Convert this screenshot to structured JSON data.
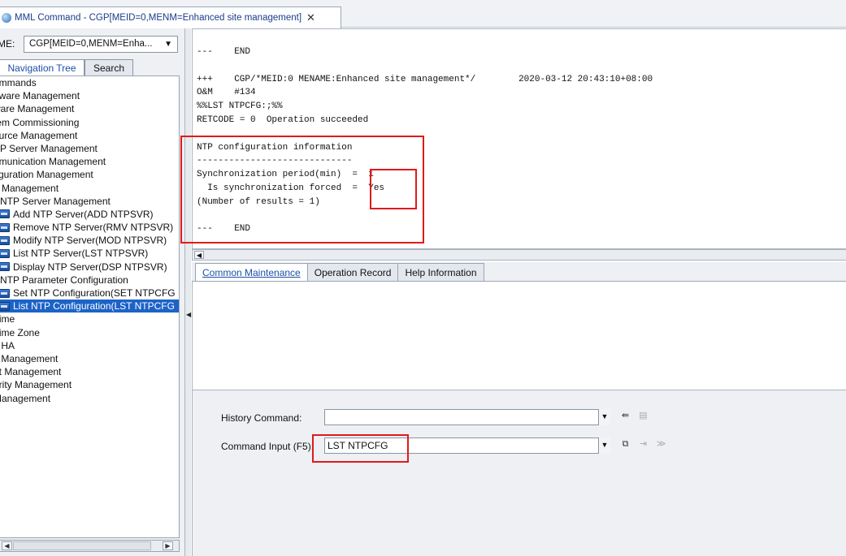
{
  "document_tab": {
    "title": "MML Command - CGP[MEID=0,MENM=Enhanced site management]",
    "close_glyph": "✕",
    "icon": "globe-icon"
  },
  "left_panel": {
    "ne_label": "ME:",
    "ne_value": "CGP[MEID=0,MENM=Enha...",
    "tabs": [
      "Navigation Tree",
      "Search"
    ],
    "tree": [
      {
        "label": "ommands",
        "level": 1
      },
      {
        "label": "dware Management",
        "level": 1
      },
      {
        "label": "ware Management",
        "level": 1
      },
      {
        "label": "tem Commissioning",
        "level": 1
      },
      {
        "label": "ource Management",
        "level": 1
      },
      {
        "label": "AP Server Management",
        "level": 1
      },
      {
        "label": "nmunication Management",
        "level": 1
      },
      {
        "label": "figuration Management",
        "level": 1
      },
      {
        "label": "e Management",
        "level": 1
      },
      {
        "label": "NTP Server Management",
        "level": 2
      },
      {
        "label": "Add NTP Server(ADD NTPSVR)",
        "level": 3
      },
      {
        "label": "Remove NTP Server(RMV NTPSVR)",
        "level": 3
      },
      {
        "label": "Modify NTP Server(MOD NTPSVR)",
        "level": 3
      },
      {
        "label": "List NTP Server(LST NTPSVR)",
        "level": 3
      },
      {
        "label": "Display NTP Server(DSP NTPSVR)",
        "level": 3
      },
      {
        "label": "NTP Parameter Configuration",
        "level": 2
      },
      {
        "label": "Set NTP Configuration(SET NTPCFG",
        "level": 3
      },
      {
        "label": "List NTP Configuration(LST NTPCFG",
        "level": 3,
        "selected": true
      },
      {
        "label": "Time",
        "level": 1
      },
      {
        "label": "Time Zone",
        "level": 1
      },
      {
        "label": "J HA",
        "level": 1
      },
      {
        "label": "lt Management",
        "level": 1
      },
      {
        "label": "nt Management",
        "level": 1
      },
      {
        "label": "urity Management",
        "level": 1
      },
      {
        "label": " Management",
        "level": 1
      }
    ]
  },
  "output": {
    "lines": [
      "---    END",
      "",
      "+++    CGP/*MEID:0 MENAME:Enhanced site management*/        2020-03-12 20:43:10+08:00",
      "O&M    #134",
      "%%LST NTPCFG:;%%",
      "RETCODE = 0  Operation succeeded",
      "",
      "NTP configuration information",
      "-----------------------------",
      "Synchronization period(min)  =  1",
      "  Is synchronization forced  =  Yes",
      "(Number of results = 1)",
      "",
      "---    END"
    ]
  },
  "bottom_tabs": [
    "Common Maintenance",
    "Operation Record",
    "Help Information"
  ],
  "command_panel": {
    "history_label": "History Command:",
    "history_value": "",
    "input_label": "Command Input (F5):",
    "input_value": "LST NTPCFG"
  },
  "highlight_color": "#e01a1a",
  "selection_color": "#1c63c7"
}
